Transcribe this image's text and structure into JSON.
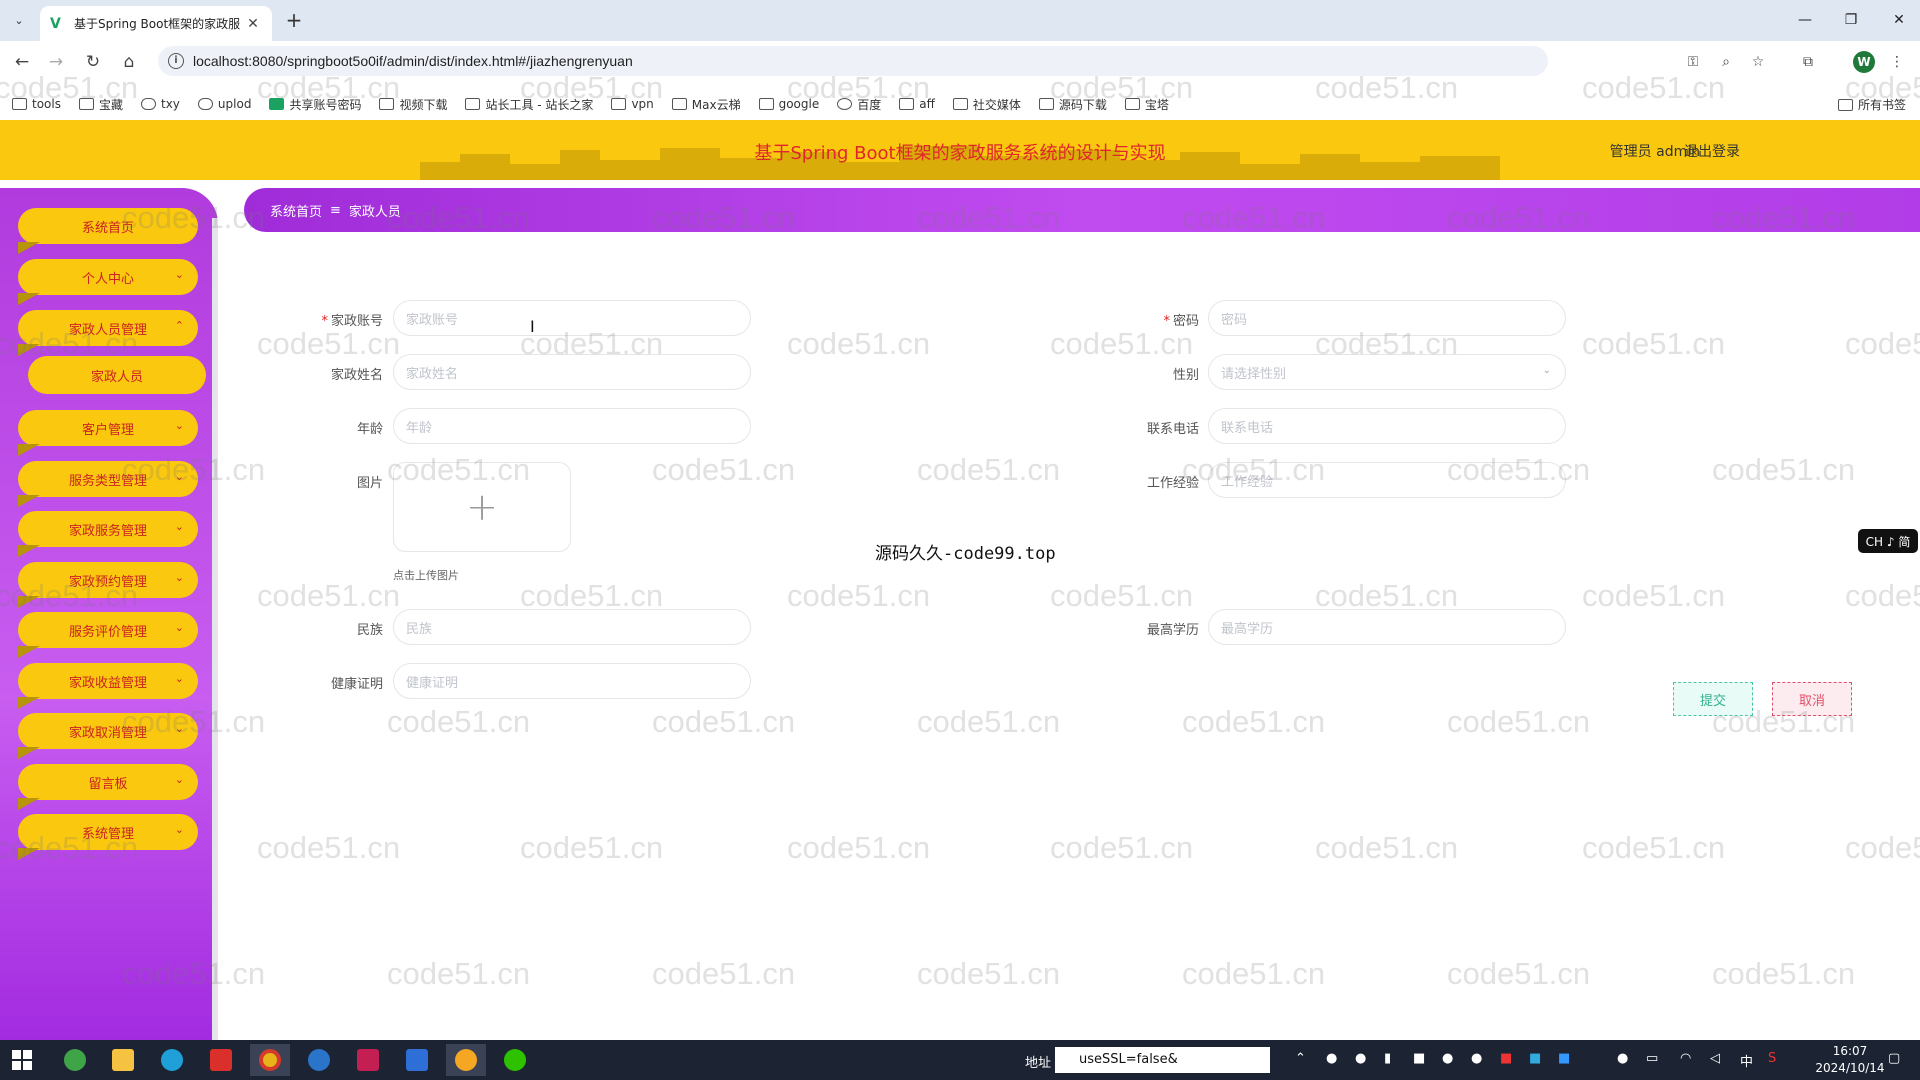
{
  "browser": {
    "tab_title": "基于Spring Boot框架的家政服",
    "url": "localhost:8080/springboot5o0if/admin/dist/index.html#/jiazhengrenyuan",
    "profile_initial": "W",
    "bookmarks": [
      "tools",
      "宝藏",
      "txy",
      "uplod",
      "共享账号密码",
      "视频下载",
      "站长工具 - 站长之家",
      "vpn",
      "Max云梯",
      "google",
      "百度",
      "aff",
      "社交媒体",
      "源码下载",
      "宝塔"
    ],
    "all_bookmarks": "所有书签"
  },
  "header": {
    "title": "基于Spring Boot框架的家政服务系统的设计与实现",
    "user": "管理员 admin",
    "logout": "退出登录"
  },
  "sidebar": {
    "items": [
      "系统首页",
      "个人中心",
      "家政人员管理",
      "客户管理",
      "服务类型管理",
      "家政服务管理",
      "家政预约管理",
      "服务评价管理",
      "家政收益管理",
      "家政取消管理",
      "留言板",
      "系统管理"
    ],
    "active_sub": "家政人员"
  },
  "breadcrumb": {
    "home": "系统首页",
    "current": "家政人员"
  },
  "form": {
    "account": {
      "label": "家政账号",
      "placeholder": "家政账号",
      "required": "*"
    },
    "password": {
      "label": "密码",
      "placeholder": "密码",
      "required": "*"
    },
    "name": {
      "label": "家政姓名",
      "placeholder": "家政姓名"
    },
    "gender": {
      "label": "性别",
      "placeholder": "请选择性别"
    },
    "age": {
      "label": "年龄",
      "placeholder": "年龄"
    },
    "phone": {
      "label": "联系电话",
      "placeholder": "联系电话"
    },
    "image": {
      "label": "图片",
      "tip": "点击上传图片"
    },
    "experience": {
      "label": "工作经验",
      "placeholder": "工作经验"
    },
    "ethnicity": {
      "label": "民族",
      "placeholder": "民族"
    },
    "education": {
      "label": "最高学历",
      "placeholder": "最高学历"
    },
    "health": {
      "label": "健康证明",
      "placeholder": "健康证明"
    },
    "submit": "提交",
    "cancel": "取消"
  },
  "overlay": {
    "center_note": "源码久久-code99.top",
    "ime": "CH ♪ 简",
    "watermark": "code51.cn"
  },
  "taskbar": {
    "addr_label": "地址",
    "addr_value": "useSSL=false&",
    "time": "16:07",
    "date": "2024/10/14",
    "ime_zh": "中"
  },
  "colors": {
    "header_bg": "#f9c80f",
    "sidebar_bg": "#b13bde",
    "title_red": "#e0262b"
  }
}
